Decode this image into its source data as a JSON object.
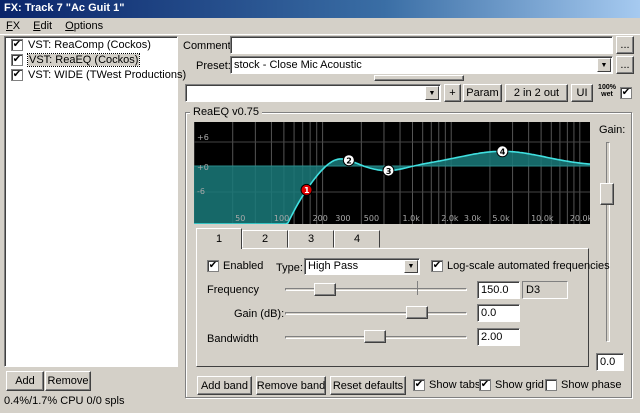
{
  "window": {
    "title": "FX: Track 7 \"Ac Guit 1\""
  },
  "menu": [
    {
      "underline": "F",
      "rest": "X"
    },
    {
      "underline": "E",
      "rest": "dit"
    },
    {
      "underline": "O",
      "rest": "ptions"
    }
  ],
  "fx_chain": [
    {
      "label": "VST: ReaComp (Cockos)",
      "enabled": true,
      "selected": false
    },
    {
      "label": "VST: ReaEQ (Cockos)",
      "enabled": true,
      "selected": true
    },
    {
      "label": "VST: WIDE (TWest Productions)",
      "enabled": true,
      "selected": false
    }
  ],
  "chain_buttons": {
    "add": "Add",
    "remove": "Remove"
  },
  "status": "0.4%/1.7% CPU 0/0 spls",
  "comment": {
    "label": "Comment:",
    "value": "",
    "more": "..."
  },
  "preset": {
    "label": "Preset:",
    "value": "stock - Close Mic Acoustic",
    "more": "..."
  },
  "toolbar": {
    "plus": "+",
    "param": "Param",
    "io": "2 in 2 out",
    "ui": "UI",
    "wet_pct": "100%",
    "wet_word": "wet",
    "wet_checked": true
  },
  "plugin": {
    "title": "ReaEQ v0.75",
    "gain_label": "Gain:",
    "gain_value": "0.0"
  },
  "graph": {
    "db_labels": [
      "+6",
      "+0",
      "-6"
    ],
    "freq_labels": [
      "50",
      "100",
      "200",
      "300",
      "500",
      "1.0k",
      "2.0k",
      "3.0k",
      "5.0k",
      "10.0k",
      "20.0k"
    ],
    "bands": [
      {
        "label": "1",
        "color": "#e00000"
      },
      {
        "label": "2",
        "color": "#ffffff"
      },
      {
        "label": "3",
        "color": "#ffffff"
      },
      {
        "label": "4",
        "color": "#ffffff"
      }
    ],
    "fill_color": "#1a7a7a",
    "curve_color": "#40e0e0"
  },
  "tabs": [
    "1",
    "2",
    "3",
    "4"
  ],
  "active_tab": 0,
  "band": {
    "enabled_label": "Enabled",
    "enabled": true,
    "type_label": "Type:",
    "type_value": "High Pass",
    "log_label": "Log-scale automated frequencies",
    "log_checked": true,
    "frequency_label": "Frequency",
    "frequency_value": "150.0",
    "note": "D3",
    "gain_label": "Gain (dB):",
    "gain_value": "0.0",
    "bandwidth_label": "Bandwidth",
    "bandwidth_value": "2.00"
  },
  "bottom": {
    "add_band": "Add band",
    "remove_band": "Remove band",
    "reset": "Reset defaults",
    "show_tabs": "Show tabs",
    "show_tabs_checked": true,
    "show_grid": "Show grid",
    "show_grid_checked": true,
    "show_phase": "Show phase",
    "show_phase_checked": false
  }
}
